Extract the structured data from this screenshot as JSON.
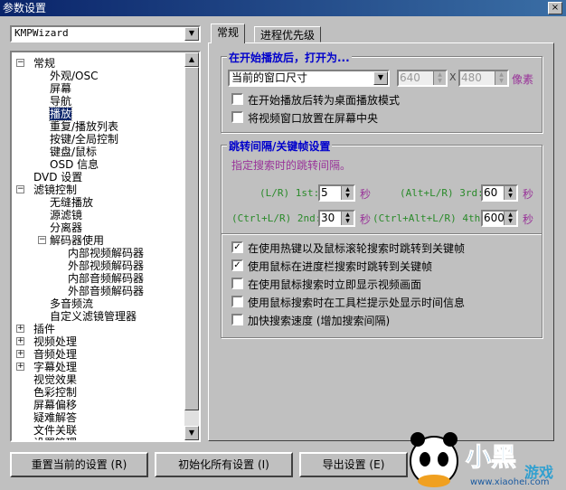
{
  "window": {
    "title": "参数设置",
    "close": "×"
  },
  "preset": {
    "value": "KMPWizard"
  },
  "tree": [
    {
      "label": "常规",
      "level": 0,
      "exp": "−"
    },
    {
      "label": "外观/OSC",
      "level": 1
    },
    {
      "label": "屏幕",
      "level": 1
    },
    {
      "label": "导航",
      "level": 1
    },
    {
      "label": "播放",
      "level": 1,
      "selected": true
    },
    {
      "label": "重复/播放列表",
      "level": 1
    },
    {
      "label": "按键/全局控制",
      "level": 1
    },
    {
      "label": "键盘/鼠标",
      "level": 1
    },
    {
      "label": "OSD 信息",
      "level": 1
    },
    {
      "label": "DVD 设置",
      "level": 0
    },
    {
      "label": "滤镜控制",
      "level": 0,
      "exp": "−"
    },
    {
      "label": "无缝播放",
      "level": 1
    },
    {
      "label": "源滤镜",
      "level": 1
    },
    {
      "label": "分离器",
      "level": 1
    },
    {
      "label": "解码器使用",
      "level": 1,
      "exp": "−"
    },
    {
      "label": "内部视频解码器",
      "level": 2
    },
    {
      "label": "外部视频解码器",
      "level": 2
    },
    {
      "label": "内部音频解码器",
      "level": 2
    },
    {
      "label": "外部音频解码器",
      "level": 2
    },
    {
      "label": "多音频流",
      "level": 1
    },
    {
      "label": "自定义滤镜管理器",
      "level": 1
    },
    {
      "label": "插件",
      "level": 0,
      "exp": "+"
    },
    {
      "label": "视频处理",
      "level": 0,
      "exp": "+"
    },
    {
      "label": "音频处理",
      "level": 0,
      "exp": "+"
    },
    {
      "label": "字幕处理",
      "level": 0,
      "exp": "+"
    },
    {
      "label": "视觉效果",
      "level": 0
    },
    {
      "label": "色彩控制",
      "level": 0
    },
    {
      "label": "屏幕偏移",
      "level": 0
    },
    {
      "label": "疑难解答",
      "level": 0
    },
    {
      "label": "文件关联",
      "level": 0
    },
    {
      "label": "设置管理",
      "level": 0
    }
  ],
  "tabs": [
    {
      "label": "常规"
    },
    {
      "label": "进程优先级"
    }
  ],
  "open_group": {
    "legend": "在开始播放后，打开为...",
    "size_mode": "当前的窗口尺寸",
    "width": "640",
    "x": "X",
    "height": "480",
    "unit": "像素",
    "checks": [
      {
        "label": "在开始播放后转为桌面播放模式",
        "checked": false
      },
      {
        "label": "将视频窗口放置在屏幕中央",
        "checked": false
      }
    ]
  },
  "seek_group": {
    "legend": "跳转间隔/关键帧设置",
    "hint": "指定搜索时的跳转间隔。",
    "fields": [
      {
        "label": "(L/R) 1st:",
        "value": "5",
        "unit": "秒"
      },
      {
        "label": "(Alt+L/R) 3rd:",
        "value": "60",
        "unit": "秒"
      },
      {
        "label": "(Ctrl+L/R) 2nd:",
        "value": "30",
        "unit": "秒"
      },
      {
        "label": "(Ctrl+Alt+L/R) 4th:",
        "value": "600",
        "unit": "秒"
      }
    ],
    "checks": [
      {
        "label": "在使用热键以及鼠标滚轮搜索时跳转到关键帧",
        "checked": true
      },
      {
        "label": "使用鼠标在进度栏搜索时跳转到关键帧",
        "checked": true
      },
      {
        "label": "在使用鼠标搜索时立即显示视频画面",
        "checked": false
      },
      {
        "label": "使用鼠标搜索时在工具栏提示处显示时间信息",
        "checked": false
      },
      {
        "label": "加快搜索速度 (增加搜索间隔)",
        "checked": false
      }
    ]
  },
  "buttons": {
    "reset": "重置当前的设置 (R)",
    "init": "初始化所有设置 (I)",
    "export": "导出设置 (E)"
  },
  "watermark": {
    "text": "小黑游戏 www.xiaohei.com"
  }
}
